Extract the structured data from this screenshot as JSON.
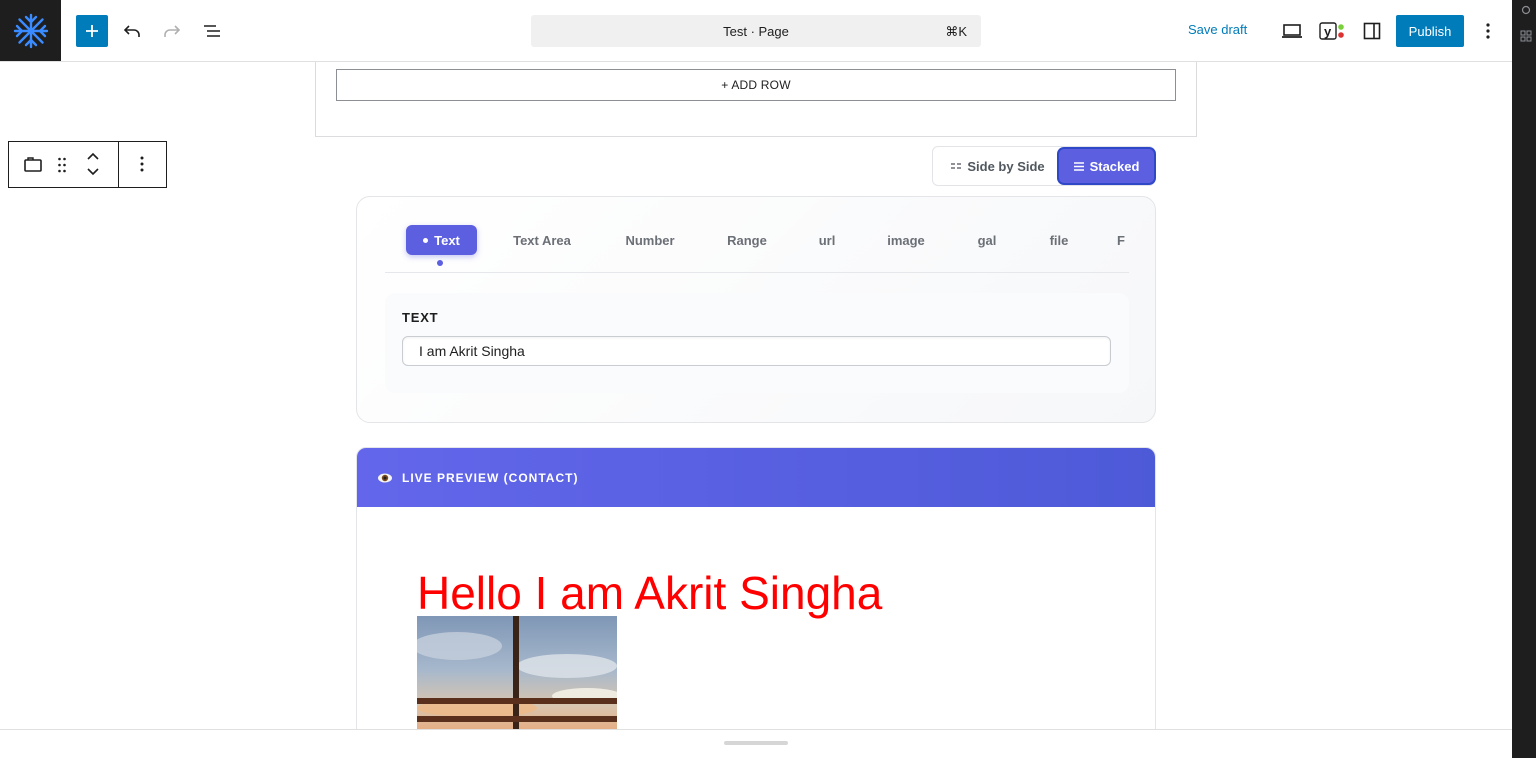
{
  "header": {
    "document_title": "Test · Page",
    "shortcut": "⌘K",
    "save_draft_label": "Save draft",
    "publish_label": "Publish"
  },
  "canvas": {
    "add_row_label": "+ ADD ROW"
  },
  "layout_switch": {
    "side_by_side_label": "Side by Side",
    "stacked_label": "Stacked",
    "selected": "Stacked"
  },
  "field_tabs": {
    "items": [
      {
        "label": "Text",
        "active": true
      },
      {
        "label": "Text Area"
      },
      {
        "label": "Number"
      },
      {
        "label": "Range"
      },
      {
        "label": "url"
      },
      {
        "label": "image"
      },
      {
        "label": "gal"
      },
      {
        "label": "file"
      },
      {
        "label": "F"
      }
    ]
  },
  "field": {
    "label": "TEXT",
    "value": "I am Akrit Singha"
  },
  "preview": {
    "title": "LIVE PREVIEW (CONTACT)",
    "heading": "Hello I am Akrit Singha",
    "heading_color": "#ff0000"
  },
  "colors": {
    "wp_blue": "#007cba",
    "accent_purple": "#5b5fe0",
    "topbar_dark": "#1e1e1e"
  }
}
